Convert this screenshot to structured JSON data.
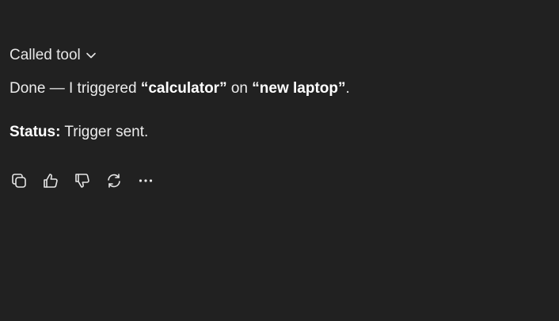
{
  "tool": {
    "label": "Called tool",
    "toggle_icon": "chevron-down-icon"
  },
  "message": {
    "line1": {
      "prefix": "Done — I triggered ",
      "target": "“calculator”",
      "middle": " on ",
      "device": "“new laptop”",
      "suffix": "."
    },
    "line2": {
      "status_label": "Status:",
      "status_value": " Trigger sent."
    }
  },
  "actions": [
    {
      "name": "copy",
      "icon": "copy-icon"
    },
    {
      "name": "thumbs-up",
      "icon": "thumbs-up-icon"
    },
    {
      "name": "thumbs-down",
      "icon": "thumbs-down-icon"
    },
    {
      "name": "regenerate",
      "icon": "refresh-icon"
    },
    {
      "name": "more",
      "icon": "more-horizontal-icon"
    }
  ],
  "colors": {
    "background": "#212121",
    "text": "#ececec"
  }
}
